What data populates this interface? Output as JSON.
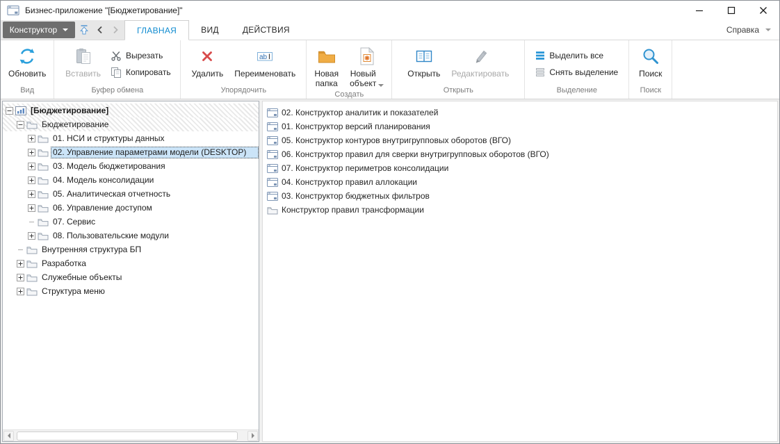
{
  "window": {
    "title": "Бизнес-приложение \"[Бюджетирование]\""
  },
  "chrome": {
    "mode_button": "Конструктор",
    "help": "Справка"
  },
  "tabs": {
    "home": "ГЛАВНАЯ",
    "view": "ВИД",
    "actions": "ДЕЙСТВИЯ"
  },
  "ribbon": {
    "refresh": "Обновить",
    "paste": "Вставить",
    "cut": "Вырезать",
    "copy": "Копировать",
    "delete": "Удалить",
    "rename": "Переименовать",
    "new_folder": "Новая папка",
    "new_object": "Новый объект",
    "open": "Открыть",
    "edit": "Редактировать",
    "select_all": "Выделить все",
    "deselect": "Снять выделение",
    "search": "Поиск",
    "captions": {
      "view": "Вид",
      "clipboard": "Буфер обмена",
      "arrange": "Упорядочить",
      "create": "Создать",
      "open": "Открыть",
      "selection": "Выделение",
      "search": "Поиск"
    }
  },
  "tree": {
    "items": [
      {
        "label": "[Бюджетирование]"
      },
      {
        "label": "Бюджетирование"
      },
      {
        "label": "01. НСИ и структуры данных"
      },
      {
        "label": "02. Управление параметрами модели (DESKTOP)"
      },
      {
        "label": "03. Модель бюджетирования"
      },
      {
        "label": "04. Модель консолидации"
      },
      {
        "label": "05. Аналитическая отчетность"
      },
      {
        "label": "06. Управление доступом"
      },
      {
        "label": "07. Сервис"
      },
      {
        "label": "08. Пользовательские модули"
      },
      {
        "label": "Внутренняя структура БП"
      },
      {
        "label": "Разработка"
      },
      {
        "label": "Служебные объекты"
      },
      {
        "label": "Структура меню"
      }
    ]
  },
  "list": {
    "items": [
      {
        "label": "02. Конструктор аналитик и показателей"
      },
      {
        "label": "01. Конструктор версий планирования"
      },
      {
        "label": "05. Конструктор контуров внутригрупповых оборотов (ВГО)"
      },
      {
        "label": "06. Конструктор правил для сверки внутригрупповых оборотов (ВГО)"
      },
      {
        "label": "07. Конструктор периметров консолидации"
      },
      {
        "label": "04. Конструктор правил аллокации"
      },
      {
        "label": "03. Конструктор бюджетных фильтров"
      },
      {
        "label": "Конструктор правил трансформации"
      }
    ]
  },
  "colors": {
    "accent_blue": "#0f8bd0",
    "selection_bg": "#cbe4f8",
    "folder_orange": "#eda93f",
    "delete_red": "#d84b4b"
  }
}
